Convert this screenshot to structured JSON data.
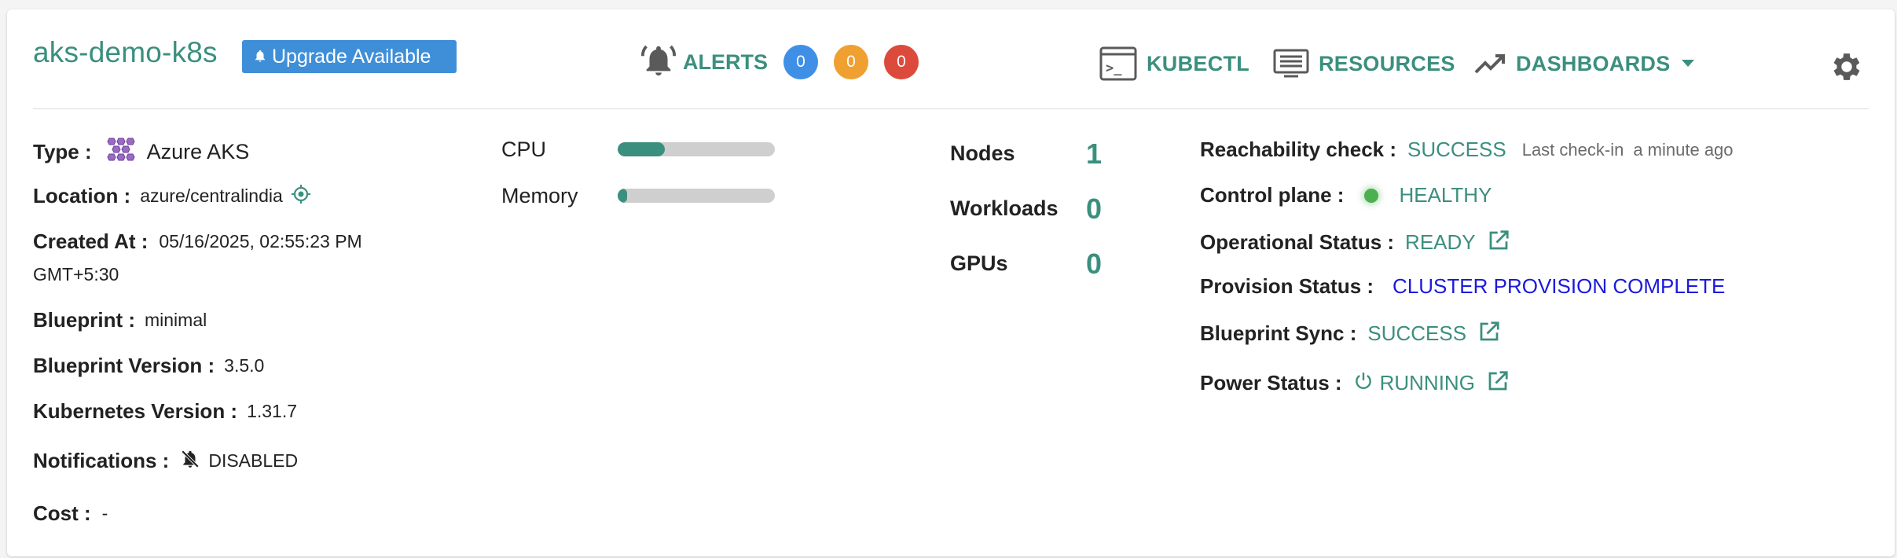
{
  "header": {
    "cluster_name": "aks-demo-k8s",
    "upgrade_badge": "Upgrade Available",
    "alerts_label": "ALERTS",
    "alert_counts": [
      {
        "value": "0",
        "color": "#3f8fe6"
      },
      {
        "value": "0",
        "color": "#f0a030"
      },
      {
        "value": "0",
        "color": "#dc4a3c"
      }
    ],
    "kubectl_label": "KUBECTL",
    "resources_label": "RESOURCES",
    "dashboards_label": "DASHBOARDS"
  },
  "details": {
    "type_label": "Type :",
    "type_value": "Azure AKS",
    "location_label": "Location :",
    "location_value": "azure/centralindia",
    "created_label": "Created At :",
    "created_value_line1": "05/16/2025, 02:55:23 PM",
    "created_value_line2": "GMT+5:30",
    "blueprint_label": "Blueprint :",
    "blueprint_value": "minimal",
    "blueprint_version_label": "Blueprint Version :",
    "blueprint_version_value": "3.5.0",
    "k8s_version_label": "Kubernetes Version :",
    "k8s_version_value": "1.31.7",
    "notifications_label": "Notifications :",
    "notifications_value": "DISABLED",
    "cost_label": "Cost :",
    "cost_value": "-"
  },
  "resources": {
    "cpu_label": "CPU",
    "cpu_usage_fraction": 0.3,
    "memory_label": "Memory",
    "memory_usage_fraction": 0.06
  },
  "counts": {
    "nodes_label": "Nodes",
    "nodes_value": "1",
    "workloads_label": "Workloads",
    "workloads_value": "0",
    "gpus_label": "GPUs",
    "gpus_value": "0"
  },
  "status": {
    "reachability_label": "Reachability check :",
    "reachability_value": "SUCCESS",
    "last_checkin_label": "Last check-in",
    "last_checkin_value": "a minute ago",
    "control_plane_label": "Control plane :",
    "control_plane_value": "HEALTHY",
    "operational_label": "Operational Status :",
    "operational_value": "READY",
    "provision_label": "Provision Status :",
    "provision_value": "CLUSTER PROVISION COMPLETE",
    "blueprint_sync_label": "Blueprint Sync :",
    "blueprint_sync_value": "SUCCESS",
    "power_label": "Power Status :",
    "power_value": "RUNNING"
  },
  "colors": {
    "accent": "#3b8f7e",
    "provision_blue": "#1a1adc",
    "healthy_dot": "#4caf50",
    "upgrade_blue": "#3f8fd8"
  },
  "icons": [
    "bell-icon",
    "alarm-icon",
    "terminal-icon",
    "list-icon",
    "trending-icon",
    "caret-down-icon",
    "gear-icon",
    "aks-logo-icon",
    "target-icon",
    "bell-off-icon",
    "external-link-icon",
    "power-icon"
  ]
}
